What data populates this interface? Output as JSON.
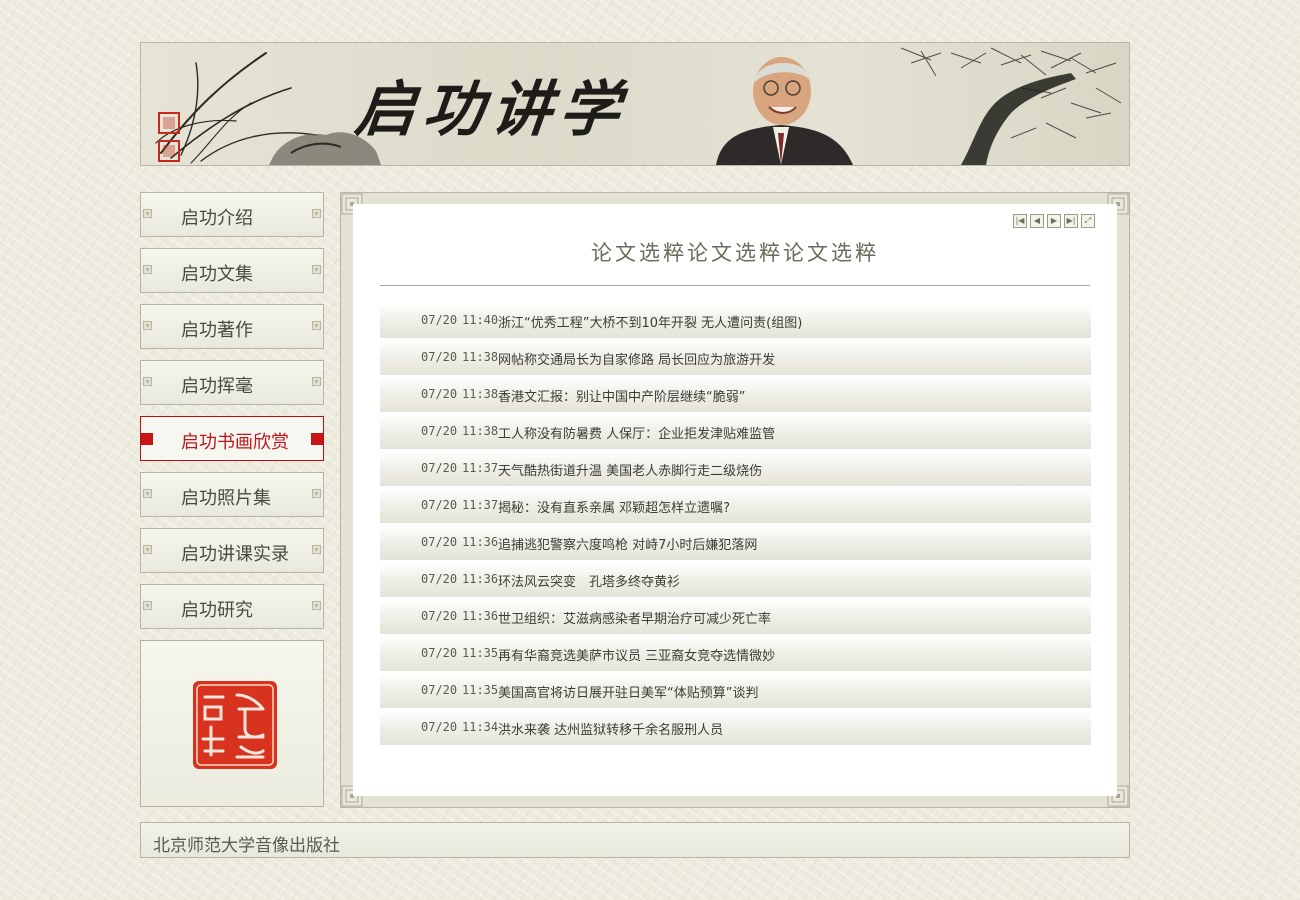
{
  "header": {
    "title": "启功讲学"
  },
  "sidebar": {
    "items": [
      {
        "label": "启功介绍",
        "active": false
      },
      {
        "label": "启功文集",
        "active": false
      },
      {
        "label": "启功著作",
        "active": false
      },
      {
        "label": "启功挥毫",
        "active": false
      },
      {
        "label": "启功书画欣赏",
        "active": true
      },
      {
        "label": "启功照片集",
        "active": false
      },
      {
        "label": "启功讲课实录",
        "active": false
      },
      {
        "label": "启功研究",
        "active": false
      }
    ],
    "seal_text": "启功"
  },
  "main": {
    "title": "论文选粹论文选粹论文选粹",
    "pager": {
      "first_icon": "first-page-icon",
      "prev_icon": "prev-page-icon",
      "next_icon": "next-page-icon",
      "last_icon": "last-page-icon",
      "expand_icon": "expand-icon"
    },
    "news": [
      {
        "date": "07/20",
        "time": "11:40",
        "headline": "浙江“优秀工程”大桥不到10年开裂 无人遭问责(组图)"
      },
      {
        "date": "07/20",
        "time": "11:38",
        "headline": "网帖称交通局长为自家修路 局长回应为旅游开发"
      },
      {
        "date": "07/20",
        "time": "11:38",
        "headline": "香港文汇报：别让中国中产阶层继续“脆弱”"
      },
      {
        "date": "07/20",
        "time": "11:38",
        "headline": "工人称没有防暑费 人保厅：企业拒发津贴难监管"
      },
      {
        "date": "07/20",
        "time": "11:37",
        "headline": "天气酷热街道升温 美国老人赤脚行走二级烧伤"
      },
      {
        "date": "07/20",
        "time": "11:37",
        "headline": "揭秘：没有直系亲属 邓颖超怎样立遗嘱?"
      },
      {
        "date": "07/20",
        "time": "11:36",
        "headline": "追捕逃犯警察六度鸣枪 对峙7小时后嫌犯落网"
      },
      {
        "date": "07/20",
        "time": "11:36",
        "headline": "环法风云突变　孔塔多终夺黄衫"
      },
      {
        "date": "07/20",
        "time": "11:36",
        "headline": "世卫组织：艾滋病感染者早期治疗可减少死亡率"
      },
      {
        "date": "07/20",
        "time": "11:35",
        "headline": "再有华裔竞选美萨市议员 三亚裔女竞夺选情微妙"
      },
      {
        "date": "07/20",
        "time": "11:35",
        "headline": "美国高官将访日展开驻日美军“体贴预算”谈判"
      },
      {
        "date": "07/20",
        "time": "11:34",
        "headline": "洪水来袭 达州监狱转移千余名服刑人员"
      }
    ]
  },
  "footer": {
    "text": "北京师范大学音像出版社"
  },
  "colors": {
    "accent_red": "#c0151a",
    "seal_red": "#d8331e",
    "background": "#ecebdd"
  }
}
